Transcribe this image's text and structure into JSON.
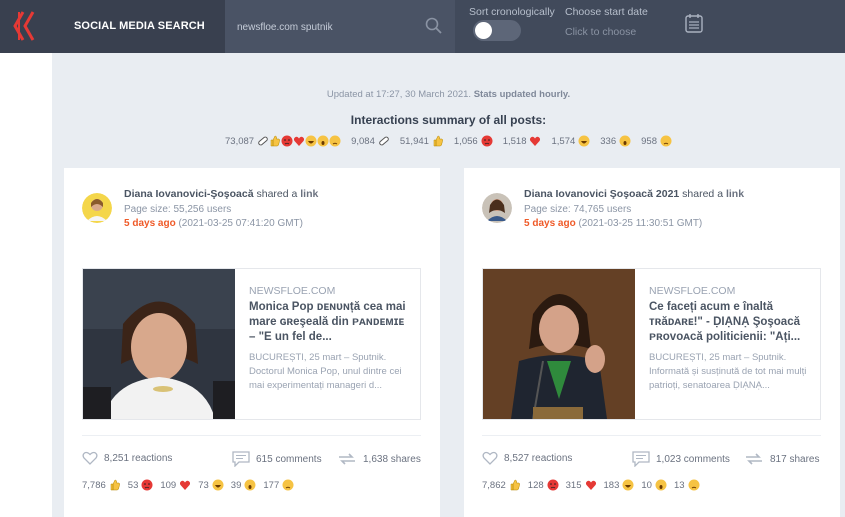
{
  "header": {
    "app_title": "SOCIAL MEDIA SEARCH",
    "search_value": "newsfloe.com sputnik",
    "sort_label": "Sort cronologically",
    "date_label": "Choose start date",
    "date_placeholder": "Click to choose"
  },
  "summary": {
    "updated_prefix": "Updated at 17:27, 30 March 2021. ",
    "updated_bold": "Stats updated hourly.",
    "title": "Interactions summary of all posts:",
    "total": "73,087",
    "care": "9,084",
    "like": "51,941",
    "angry": "1,056",
    "love": "1,518",
    "haha": "1,574",
    "wow": "336",
    "sad": "958"
  },
  "posts": [
    {
      "author": "Diana Iovanovici-Şoşoacă",
      "shared_text": " shared a ",
      "shared_link": "link",
      "page_size": "Page size: 55,256 users",
      "ago": "5 days ago",
      "timestamp": " (2021-03-25 07:41:20 GMT)",
      "domain": "NEWSFLOE.COM",
      "headline": "Monica Pop ᴅᴇɴᴜɴță cea mai mare ɢʀeşeală din ᴘᴀɴᴅᴇᴍɪᴇ – \"E un fel de...",
      "snippet": "BUCUREȘTI, 25 mart – Sputnik. Doctorul Monica Pop, unul dintre cei mai experimentați manageri d...",
      "reactions": "8,251 reactions",
      "comments": "615 comments",
      "shares": "1,638 shares",
      "like": "7,786",
      "angry": "53",
      "love": "109",
      "haha": "73",
      "wow": "39",
      "sad": "177"
    },
    {
      "author": "Diana Iovanovici Şoşoacă 2021",
      "shared_text": " shared a ",
      "shared_link": "link",
      "page_size": "Page size: 74,765 users",
      "ago": "5 days ago",
      "timestamp": " (2021-03-25 11:30:51 GMT)",
      "domain": "NEWSFLOE.COM",
      "headline": "Ce faceți acum e înaltă ᴛʀăᴅᴀʀᴇ!\" - ḌIẠNẠ Şoşoacă ᴘʀᴏᴠᴏᴀcă politicienii: \"Ați...",
      "snippet": "BUCUREȘTI, 25 mart – Sputnik. Informată și susținută de tot mai mulți patrioți, senatoarea ḌIẠNẠ...",
      "reactions": "8,527 reactions",
      "comments": "1,023 comments",
      "shares": "817 shares",
      "like": "7,862",
      "angry": "128",
      "love": "315",
      "haha": "183",
      "wow": "10",
      "sad": "13"
    }
  ],
  "colors": {
    "topbar": "#414a5b",
    "accent_logo": "#e53935",
    "time_ago": "#ef5a28"
  }
}
